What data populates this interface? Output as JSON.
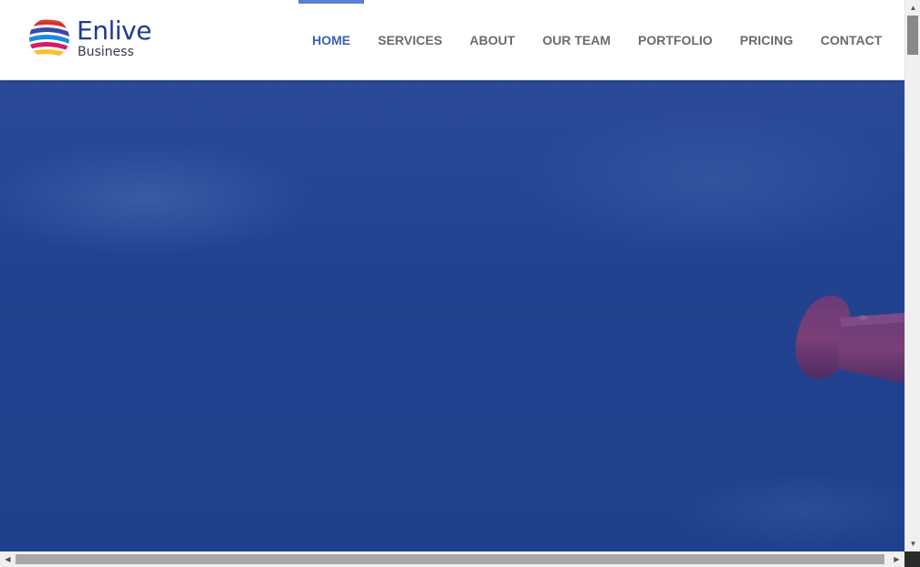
{
  "brand": {
    "title": "Enlive",
    "subtitle": "Business"
  },
  "nav": {
    "items": [
      {
        "label": "HOME",
        "active": true
      },
      {
        "label": "SERVICES",
        "active": false
      },
      {
        "label": "ABOUT",
        "active": false
      },
      {
        "label": "OUR TEAM",
        "active": false
      },
      {
        "label": "PORTFOLIO",
        "active": false
      },
      {
        "label": "PRICING",
        "active": false
      },
      {
        "label": "CONTACT",
        "active": false
      }
    ]
  },
  "colors": {
    "accent": "#5b7fd4",
    "active_text": "#3d5fb8",
    "nav_text": "#6b6b6b",
    "brand_blue": "#1f3a93",
    "hero_sky": "#21438f"
  },
  "icons": {
    "logo": "striped-globe-icon",
    "scroll_up": "arrow-up-icon",
    "scroll_down": "arrow-down-icon",
    "scroll_left": "arrow-left-icon",
    "scroll_right": "arrow-right-icon"
  }
}
